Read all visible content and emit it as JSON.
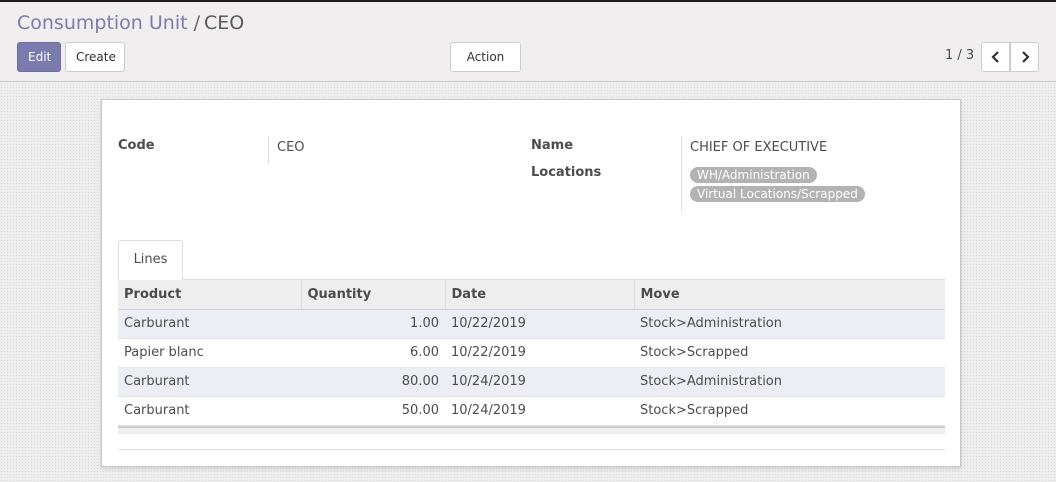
{
  "breadcrumb": {
    "parent": "Consumption Unit",
    "separator": "/",
    "current": "CEO"
  },
  "buttons": {
    "edit": "Edit",
    "create": "Create",
    "action": "Action"
  },
  "pager": {
    "value": "1 / 3"
  },
  "form": {
    "code_label": "Code",
    "code_value": "CEO",
    "name_label": "Name",
    "name_value": "CHIEF OF EXECUTIVE",
    "locations_label": "Locations",
    "locations": [
      "WH/Administration",
      "Virtual Locations/Scrapped"
    ]
  },
  "tabs": [
    {
      "label": "Lines"
    }
  ],
  "lines_table": {
    "headers": [
      "Product",
      "Quantity",
      "Date",
      "Move"
    ],
    "rows": [
      {
        "product": "Carburant",
        "quantity": "1.00",
        "date": "10/22/2019",
        "move": "Stock>Administration"
      },
      {
        "product": "Papier blanc",
        "quantity": "6.00",
        "date": "10/22/2019",
        "move": "Stock>Scrapped"
      },
      {
        "product": "Carburant",
        "quantity": "80.00",
        "date": "10/24/2019",
        "move": "Stock>Administration"
      },
      {
        "product": "Carburant",
        "quantity": "50.00",
        "date": "10/24/2019",
        "move": "Stock>Scrapped"
      }
    ]
  },
  "colors": {
    "accent": "#7c7bad",
    "tag": "#b3b3b3",
    "odd_row": "#eceef5"
  }
}
